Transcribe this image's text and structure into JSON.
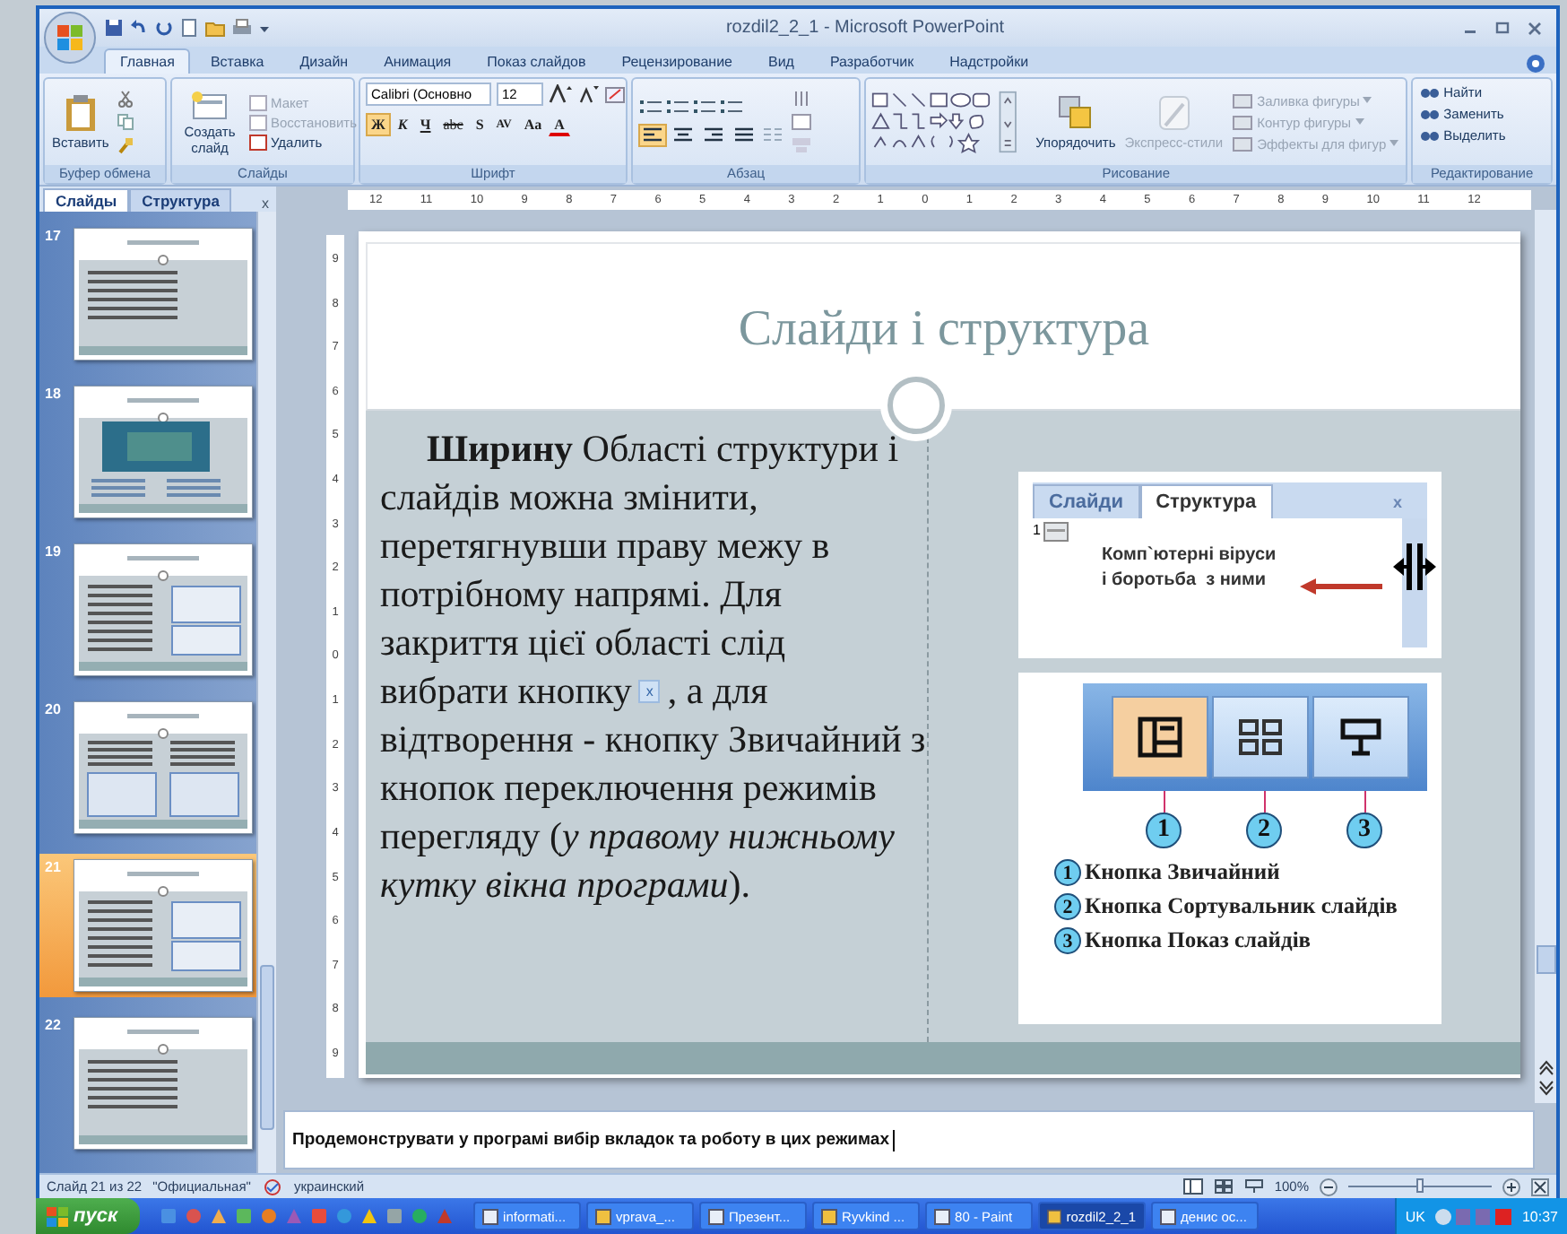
{
  "window": {
    "title": "rozdil2_2_1 - Microsoft PowerPoint"
  },
  "ribbon_tabs": [
    {
      "label": "Главная",
      "selected": true
    },
    {
      "label": "Вставка",
      "selected": false
    },
    {
      "label": "Дизайн",
      "selected": false
    },
    {
      "label": "Анимация",
      "selected": false
    },
    {
      "label": "Показ слайдов",
      "selected": false
    },
    {
      "label": "Рецензирование",
      "selected": false
    },
    {
      "label": "Вид",
      "selected": false
    },
    {
      "label": "Разработчик",
      "selected": false
    },
    {
      "label": "Надстройки",
      "selected": false
    }
  ],
  "ribbon": {
    "clipboard": {
      "label": "Буфер обмена",
      "paste": "Вставить"
    },
    "slides": {
      "label": "Слайды",
      "new_slide": "Создать слайд",
      "items": [
        {
          "label": "Макет",
          "disabled": true
        },
        {
          "label": "Восстановить",
          "disabled": true
        },
        {
          "label": "Удалить",
          "disabled": false
        }
      ]
    },
    "font": {
      "label": "Шрифт",
      "font_name": "Calibri (Основно",
      "font_size": "12",
      "format_buttons": [
        {
          "label": "Ж",
          "selected": true
        },
        {
          "label": "К",
          "selected": false
        },
        {
          "label": "Ч",
          "selected": false
        },
        {
          "label": "abc",
          "selected": false
        },
        {
          "label": "S",
          "selected": false
        },
        {
          "label": "AV",
          "selected": false
        },
        {
          "label": "Aa",
          "selected": false
        },
        {
          "label": "A",
          "selected": false
        }
      ]
    },
    "paragraph": {
      "label": "Абзац",
      "align_buttons": [
        {
          "kind": "left",
          "selected": true
        },
        {
          "kind": "center",
          "selected": false
        },
        {
          "kind": "right",
          "selected": false
        },
        {
          "kind": "justify",
          "selected": false
        }
      ]
    },
    "drawing": {
      "label": "Рисование",
      "arrange": "Упорядочить",
      "quick_styles": {
        "label": "Экспресс-стили",
        "disabled": true
      },
      "shape_items": [
        {
          "label": "Заливка фигуры",
          "disabled": true
        },
        {
          "label": "Контур фигуры",
          "disabled": true
        },
        {
          "label": "Эффекты для фигур",
          "disabled": true
        }
      ]
    },
    "editing": {
      "label": "Редактирование",
      "items": [
        "Найти",
        "Заменить",
        "Выделить"
      ]
    }
  },
  "slides_pane": {
    "tabs": [
      {
        "label": "Слайды",
        "selected": true
      },
      {
        "label": "Структура",
        "selected": false
      }
    ],
    "close": "x",
    "thumbnails": [
      {
        "number": "17",
        "kind": "text",
        "selected": false
      },
      {
        "number": "18",
        "kind": "image",
        "selected": false
      },
      {
        "number": "19",
        "kind": "split",
        "selected": false
      },
      {
        "number": "20",
        "kind": "double",
        "selected": false
      },
      {
        "number": "21",
        "kind": "split",
        "selected": true
      },
      {
        "number": "22",
        "kind": "text",
        "selected": false
      }
    ]
  },
  "rulers": {
    "horizontal": [
      "12",
      "11",
      "10",
      "9",
      "8",
      "7",
      "6",
      "5",
      "4",
      "3",
      "2",
      "1",
      "0",
      "1",
      "2",
      "3",
      "4",
      "5",
      "6",
      "7",
      "8",
      "9",
      "10",
      "11",
      "12"
    ],
    "vertical": [
      "9",
      "8",
      "7",
      "6",
      "5",
      "4",
      "3",
      "2",
      "1",
      "0",
      "1",
      "2",
      "3",
      "4",
      "5",
      "6",
      "7",
      "8",
      "9"
    ]
  },
  "slide": {
    "title": "Слайди і структура",
    "body_top": "**Ширину** Області структури і слайдів можна змінити, перетягнувши праву межу в потрібному напрямі. Для закриття цієї області слід",
    "icon_line_before": "вибрати кнопку",
    "inline_button": "x",
    "icon_line_after": ", а для",
    "body_bottom": "відтворення - кнопку Звичайний з кнопок переключення режимів перегляду (*у правому нижньому кутку вікна програми*).",
    "pane_image": {
      "tabs": [
        {
          "label": "Слайди",
          "selected": false
        },
        {
          "label": "Структура",
          "selected": true
        }
      ],
      "close": "x",
      "slide_number": "1",
      "outline": [
        "Комп`ютерні віруси",
        "і боротьба  з ними"
      ]
    },
    "views_image": {
      "buttons": [
        {
          "kind": "normal",
          "selected": true
        },
        {
          "kind": "sorter",
          "selected": false
        },
        {
          "kind": "show",
          "selected": false
        }
      ],
      "callouts": [
        "1",
        "2",
        "3"
      ],
      "legend": [
        {
          "number": "1",
          "text": "Кнопка Звичайний"
        },
        {
          "number": "2",
          "text": "Кнопка Сортувальник слайдів"
        },
        {
          "number": "3",
          "text": "Кнопка Показ слайдів"
        }
      ]
    }
  },
  "notes": "Продемонструвати у програмі вибір вкладок та роботу в цих режимах",
  "status_bar": {
    "items": [
      "Слайд 21 из 22",
      "\"Официальная\"",
      "украинский"
    ],
    "zoom": "100%",
    "zoom_level": {
      "level": 0.5
    }
  },
  "taskbar": {
    "start": "пуск",
    "tasks": [
      {
        "label": "informati...",
        "selected": false
      },
      {
        "label": "vprava_...",
        "selected": false
      },
      {
        "label": "Презент...",
        "selected": false
      },
      {
        "label": "Ryvkind ...",
        "selected": false
      },
      {
        "label": "80 - Paint",
        "selected": false
      },
      {
        "label": "rozdil2_2_1",
        "selected": true
      },
      {
        "label": "денис ос...",
        "selected": false
      }
    ],
    "language": "UK",
    "clock": "10:37"
  }
}
